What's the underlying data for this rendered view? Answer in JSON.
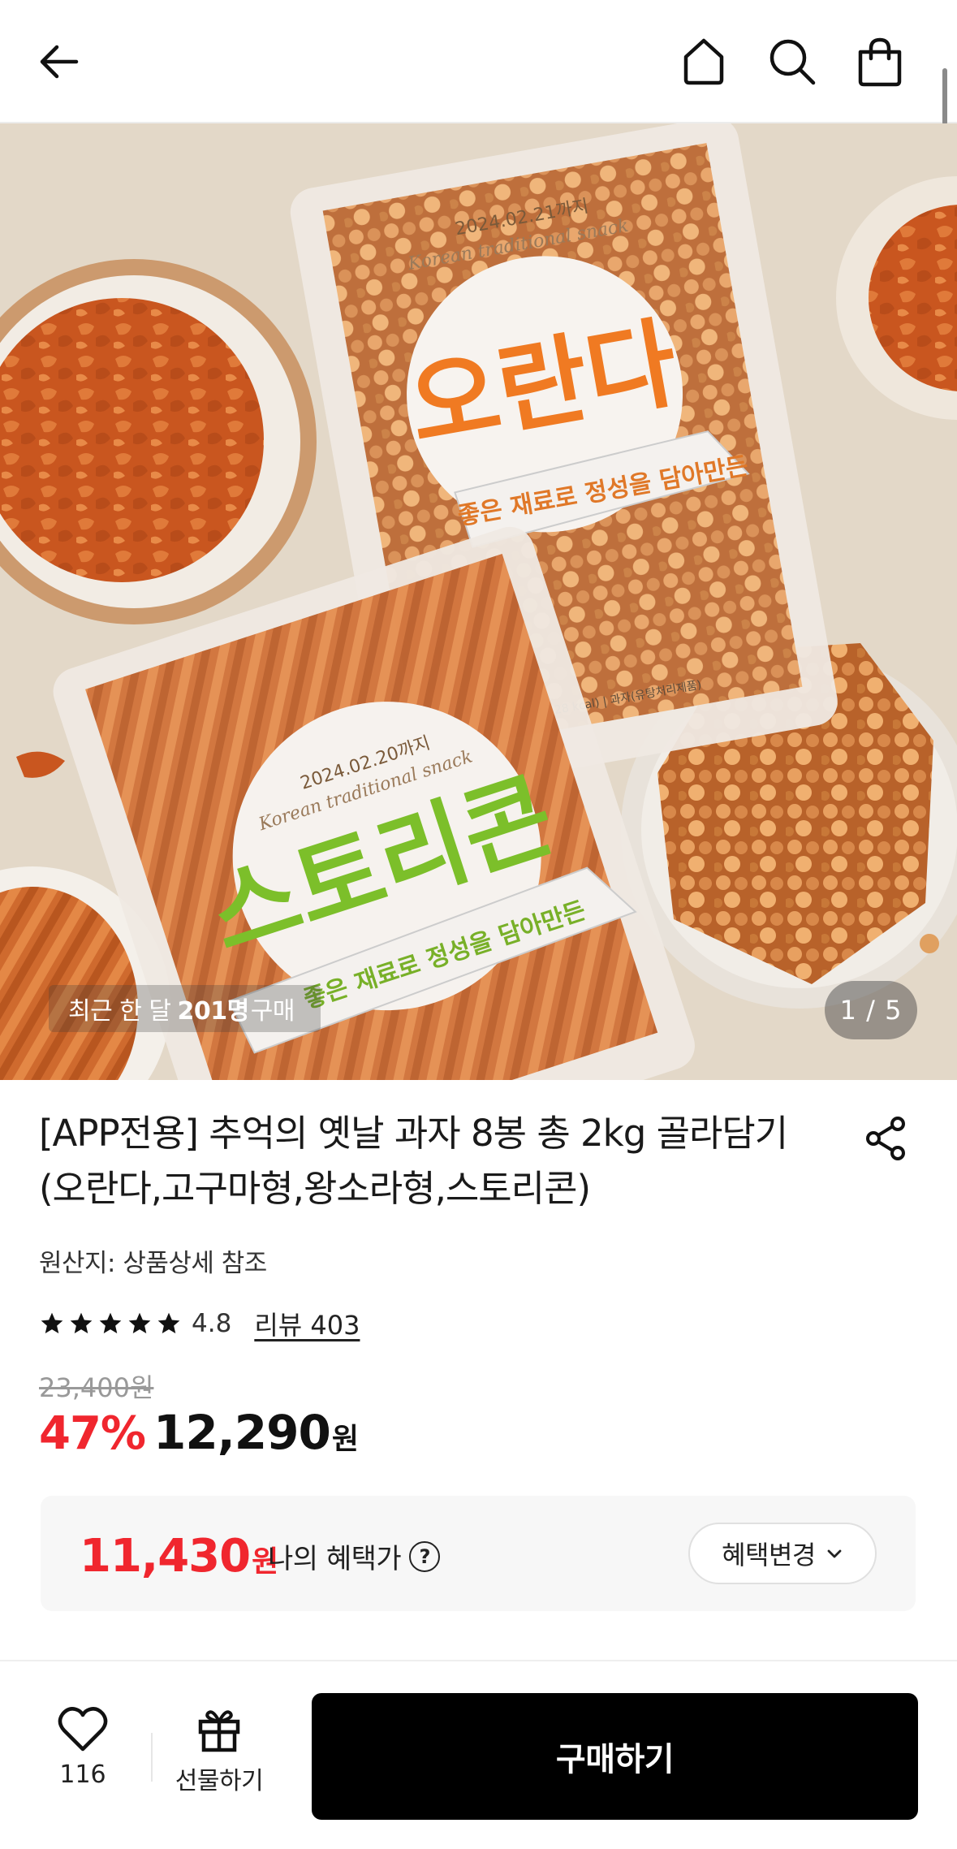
{
  "header": {
    "back_icon": "arrow-left-icon",
    "home_icon": "home-icon",
    "search_icon": "search-icon",
    "cart_icon": "shopping-bag-icon"
  },
  "hero": {
    "recent_prefix": "최근 한 달",
    "recent_count": "201명",
    "recent_suffix": "구매",
    "page_indicator": "1 / 5",
    "package_top": {
      "name": "오란다",
      "date": "2024.02.21까지",
      "subtitle": "Korean traditional snack",
      "ribbon": "좋은 재료로 정성을 담아만든",
      "net": "250 g (1,128 kcal) | 과자(유탕처리제품)"
    },
    "package_bottom": {
      "name": "스토리콘",
      "date": "2024.02.20까지",
      "subtitle": "Korean traditional snack",
      "ribbon": "좋은 재료로 정성을 담아만든"
    }
  },
  "product": {
    "title": "[APP전용] 추억의 옛날 과자 8봉 총 2kg 골라담기 (오란다,고구마형,왕소라형,스토리콘)",
    "origin": "원산지: 상품상세 참조",
    "rating": "4.8",
    "review": "리뷰 403",
    "original_price": "23,400원",
    "discount": "47%",
    "price": "12,290",
    "price_unit": "원",
    "share_icon": "share-icon"
  },
  "benefit": {
    "price": "11,430",
    "unit": "원",
    "label": "나의 혜택가",
    "help": "?",
    "change_button": "혜택변경"
  },
  "bottom_bar": {
    "wish_count": "116",
    "gift_label": "선물하기",
    "buy_label": "구매하기"
  },
  "colors": {
    "accent_red": "#f0262e",
    "buy_button": "#000000",
    "hero_background": "#e3d8c8",
    "snack_orange": "#d2652c",
    "oranda_text": "#f07a22",
    "storycorn_text": "#7cbf2a"
  }
}
